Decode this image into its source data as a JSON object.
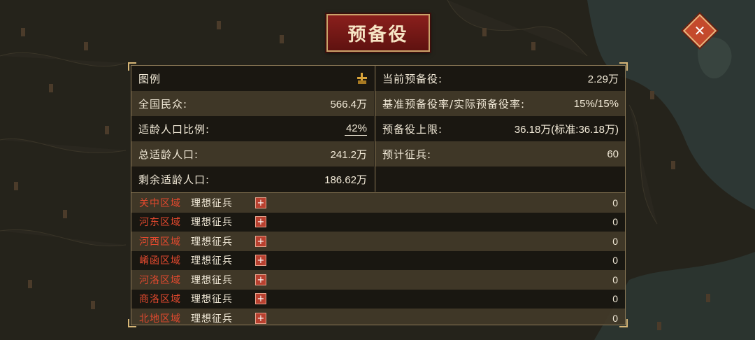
{
  "title": "预备役",
  "close_icon": "close-icon",
  "stats_left": [
    {
      "label": "图例",
      "value": "",
      "icon": "legend-icon"
    },
    {
      "label": "全国民众:",
      "value": "566.4万"
    },
    {
      "label": "适龄人口比例:",
      "value": "42%"
    },
    {
      "label": "总适龄人口:",
      "value": "241.2万"
    },
    {
      "label": "剩余适龄人口:",
      "value": "186.62万"
    }
  ],
  "stats_right": [
    {
      "label": "当前预备役:",
      "value": "2.29万"
    },
    {
      "label": "基准预备役率/实际预备役率:",
      "value": "15%/15%"
    },
    {
      "label": "预备役上限:",
      "value": "36.18万(标准:36.18万)"
    },
    {
      "label": "预计征兵:",
      "value": "60"
    }
  ],
  "regions": [
    {
      "name": "关中区域",
      "action": "理想征兵",
      "value": "0"
    },
    {
      "name": "河东区域",
      "action": "理想征兵",
      "value": "0"
    },
    {
      "name": "河西区域",
      "action": "理想征兵",
      "value": "0"
    },
    {
      "name": "崤函区域",
      "action": "理想征兵",
      "value": "0"
    },
    {
      "name": "河洛区域",
      "action": "理想征兵",
      "value": "0"
    },
    {
      "name": "商洛区域",
      "action": "理想征兵",
      "value": "0"
    },
    {
      "name": "北地区域",
      "action": "理想征兵",
      "value": "0"
    }
  ],
  "plus_label": "+",
  "colors": {
    "accent_red": "#e2492e",
    "plaque": "#8a1f1c",
    "gold": "#d7b677"
  }
}
